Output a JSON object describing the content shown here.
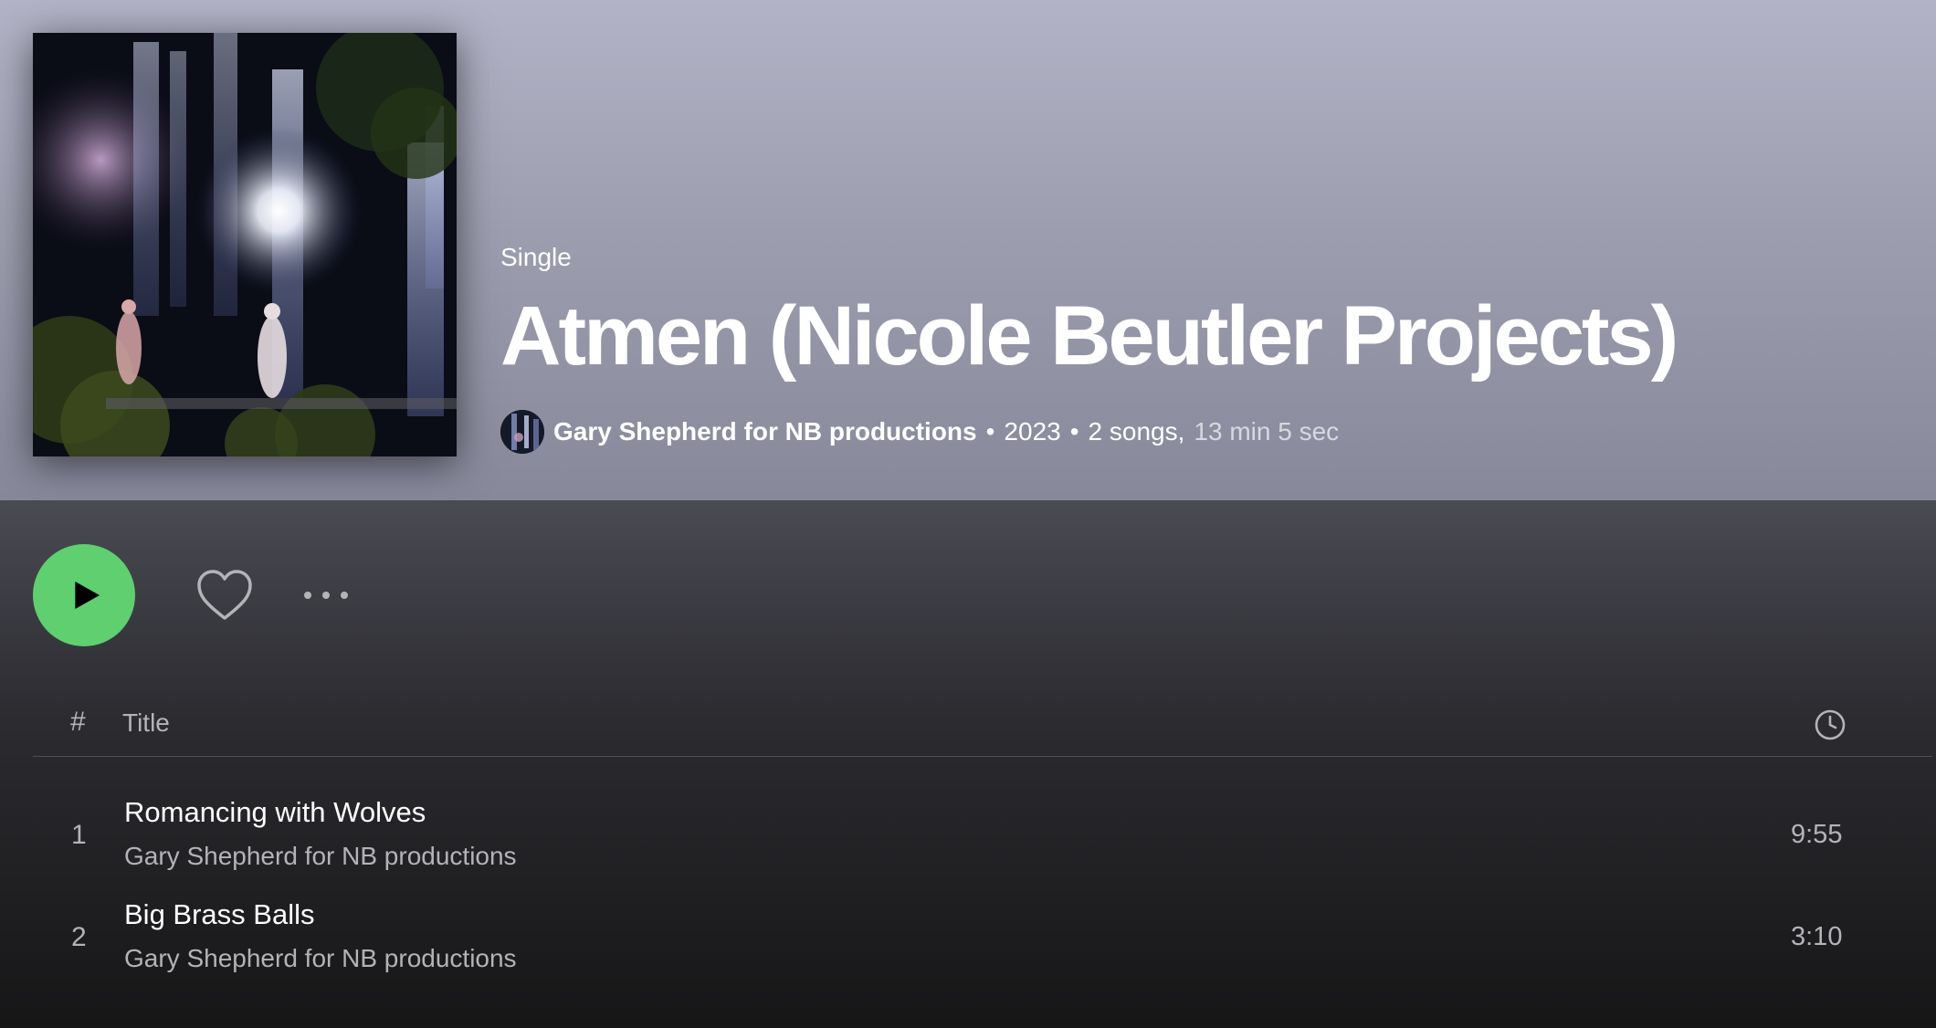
{
  "album": {
    "type_label": "Single",
    "title": "Atmen (Nicole Beutler Projects)",
    "artist": "Gary Shepherd for NB productions",
    "separator": "•",
    "year": "2023",
    "songs_count": "2 songs,",
    "total_duration": "13 min 5 sec"
  },
  "actions": {
    "play_icon": "play-icon",
    "like_icon": "heart-icon",
    "more_icon": "more-dots-icon",
    "play_color": "#5fcf70"
  },
  "table": {
    "col_number": "#",
    "col_title": "Title",
    "col_duration_icon": "clock-icon",
    "tracks": [
      {
        "number": "1",
        "title": "Romancing with Wolves",
        "artist": "Gary Shepherd for NB productions",
        "duration": "9:55"
      },
      {
        "number": "2",
        "title": "Big Brass Balls",
        "artist": "Gary Shepherd for NB productions",
        "duration": "3:10"
      }
    ]
  }
}
